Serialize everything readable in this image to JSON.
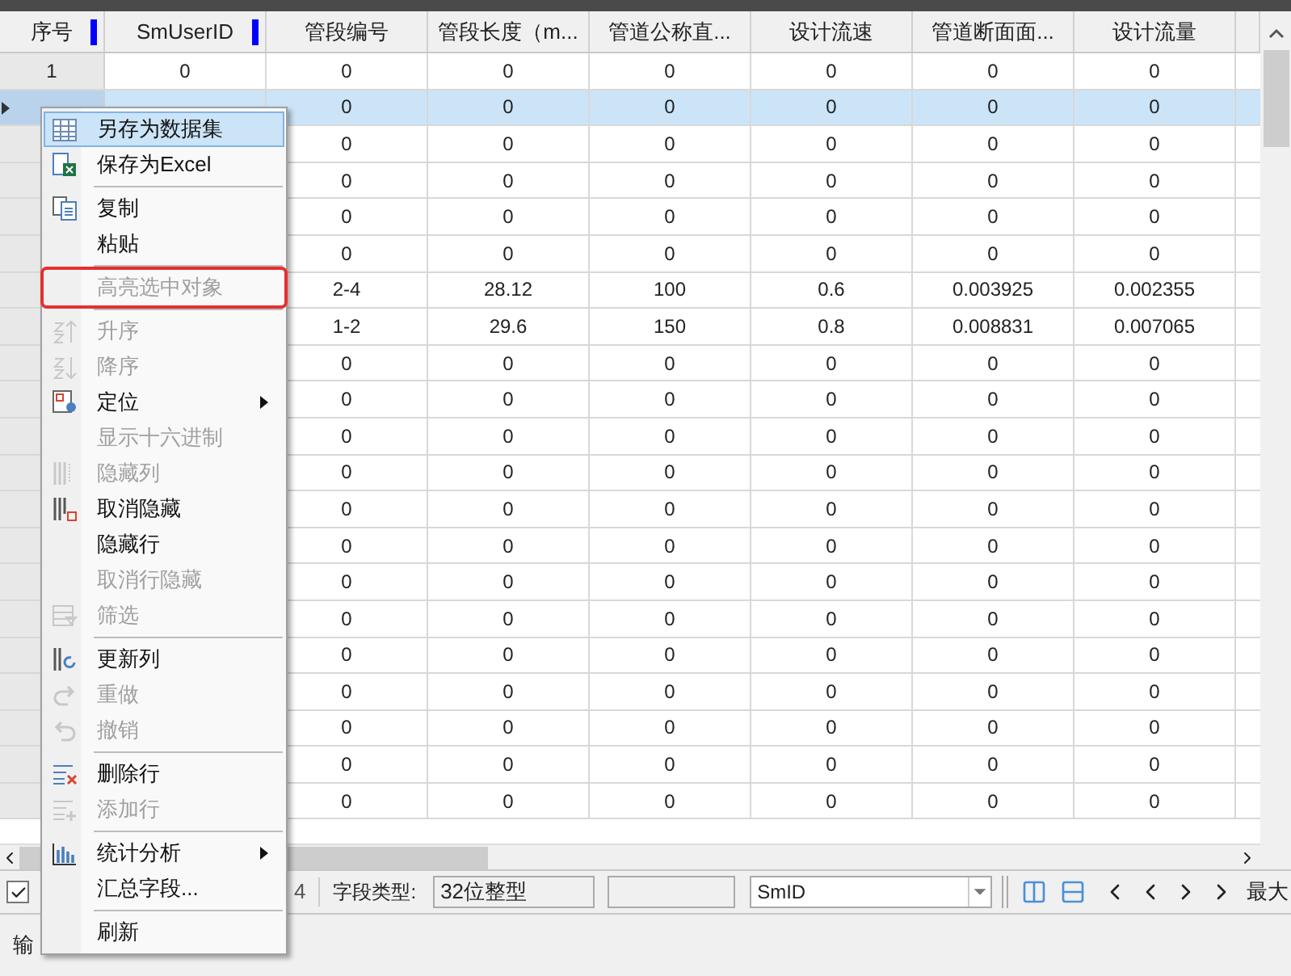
{
  "table": {
    "columns": [
      "序号",
      "SmUserID",
      "管段编号",
      "管段长度（m...",
      "管道公称直...",
      "设计流速",
      "管道断面面...",
      "设计流量"
    ],
    "rows": [
      {
        "selected": false,
        "cells": [
          "1",
          "0",
          "0",
          "0",
          "0",
          "0",
          "0",
          "0"
        ]
      },
      {
        "selected": true,
        "cells": [
          "",
          "",
          "0",
          "0",
          "0",
          "0",
          "0",
          "0"
        ]
      },
      {
        "selected": false,
        "cells": [
          "",
          "",
          "0",
          "0",
          "0",
          "0",
          "0",
          "0"
        ]
      },
      {
        "selected": false,
        "cells": [
          "",
          "",
          "0",
          "0",
          "0",
          "0",
          "0",
          "0"
        ]
      },
      {
        "selected": false,
        "cells": [
          "",
          "",
          "0",
          "0",
          "0",
          "0",
          "0",
          "0"
        ]
      },
      {
        "selected": false,
        "cells": [
          "",
          "",
          "0",
          "0",
          "0",
          "0",
          "0",
          "0"
        ]
      },
      {
        "selected": false,
        "cells": [
          "",
          "",
          "2-4",
          "28.12",
          "100",
          "0.6",
          "0.003925",
          "0.002355"
        ]
      },
      {
        "selected": false,
        "cells": [
          "",
          "",
          "1-2",
          "29.6",
          "150",
          "0.8",
          "0.008831",
          "0.007065"
        ]
      },
      {
        "selected": false,
        "cells": [
          "",
          "",
          "0",
          "0",
          "0",
          "0",
          "0",
          "0"
        ]
      },
      {
        "selected": false,
        "cells": [
          "",
          "",
          "0",
          "0",
          "0",
          "0",
          "0",
          "0"
        ]
      },
      {
        "selected": false,
        "cells": [
          "",
          "",
          "0",
          "0",
          "0",
          "0",
          "0",
          "0"
        ]
      },
      {
        "selected": false,
        "cells": [
          "",
          "",
          "0",
          "0",
          "0",
          "0",
          "0",
          "0"
        ]
      },
      {
        "selected": false,
        "cells": [
          "",
          "",
          "0",
          "0",
          "0",
          "0",
          "0",
          "0"
        ]
      },
      {
        "selected": false,
        "cells": [
          "",
          "",
          "0",
          "0",
          "0",
          "0",
          "0",
          "0"
        ]
      },
      {
        "selected": false,
        "cells": [
          "",
          "",
          "0",
          "0",
          "0",
          "0",
          "0",
          "0"
        ]
      },
      {
        "selected": false,
        "cells": [
          "",
          "",
          "0",
          "0",
          "0",
          "0",
          "0",
          "0"
        ]
      },
      {
        "selected": false,
        "cells": [
          "",
          "",
          "0",
          "0",
          "0",
          "0",
          "0",
          "0"
        ]
      },
      {
        "selected": false,
        "cells": [
          "",
          "",
          "0",
          "0",
          "0",
          "0",
          "0",
          "0"
        ]
      },
      {
        "selected": false,
        "cells": [
          "",
          "",
          "0",
          "0",
          "0",
          "0",
          "0",
          "0"
        ]
      },
      {
        "selected": false,
        "cells": [
          "",
          "",
          "0",
          "0",
          "0",
          "0",
          "0",
          "0"
        ]
      },
      {
        "selected": false,
        "cells": [
          "",
          "",
          "0",
          "0",
          "0",
          "0",
          "0",
          "0"
        ]
      }
    ]
  },
  "context_menu": [
    {
      "kind": "item",
      "label": "另存为数据集",
      "disabled": false,
      "selected": true,
      "submenu": false,
      "annotated": false
    },
    {
      "kind": "item",
      "label": "保存为Excel",
      "disabled": false,
      "selected": false,
      "submenu": false,
      "annotated": false
    },
    {
      "kind": "separator"
    },
    {
      "kind": "item",
      "label": "复制",
      "disabled": false,
      "selected": false,
      "submenu": false,
      "annotated": false
    },
    {
      "kind": "item",
      "label": "粘贴",
      "disabled": false,
      "selected": false,
      "submenu": false,
      "annotated": false
    },
    {
      "kind": "separator"
    },
    {
      "kind": "item",
      "label": "高亮选中对象",
      "disabled": true,
      "selected": false,
      "submenu": false,
      "annotated": true
    },
    {
      "kind": "separator"
    },
    {
      "kind": "item",
      "label": "升序",
      "disabled": true,
      "selected": false,
      "submenu": false,
      "annotated": false
    },
    {
      "kind": "item",
      "label": "降序",
      "disabled": true,
      "selected": false,
      "submenu": false,
      "annotated": false
    },
    {
      "kind": "item",
      "label": "定位",
      "disabled": false,
      "selected": false,
      "submenu": true,
      "annotated": false
    },
    {
      "kind": "item",
      "label": "显示十六进制",
      "disabled": true,
      "selected": false,
      "submenu": false,
      "annotated": false
    },
    {
      "kind": "item",
      "label": "隐藏列",
      "disabled": true,
      "selected": false,
      "submenu": false,
      "annotated": false
    },
    {
      "kind": "item",
      "label": "取消隐藏",
      "disabled": false,
      "selected": false,
      "submenu": false,
      "annotated": false
    },
    {
      "kind": "item",
      "label": "隐藏行",
      "disabled": false,
      "selected": false,
      "submenu": false,
      "annotated": false
    },
    {
      "kind": "item",
      "label": "取消行隐藏",
      "disabled": true,
      "selected": false,
      "submenu": false,
      "annotated": false
    },
    {
      "kind": "item",
      "label": "筛选",
      "disabled": true,
      "selected": false,
      "submenu": false,
      "annotated": false
    },
    {
      "kind": "separator"
    },
    {
      "kind": "item",
      "label": "更新列",
      "disabled": false,
      "selected": false,
      "submenu": false,
      "annotated": false
    },
    {
      "kind": "item",
      "label": "重做",
      "disabled": true,
      "selected": false,
      "submenu": false,
      "annotated": false
    },
    {
      "kind": "item",
      "label": "撤销",
      "disabled": true,
      "selected": false,
      "submenu": false,
      "annotated": false
    },
    {
      "kind": "separator"
    },
    {
      "kind": "item",
      "label": "删除行",
      "disabled": false,
      "selected": false,
      "submenu": false,
      "annotated": false
    },
    {
      "kind": "item",
      "label": "添加行",
      "disabled": true,
      "selected": false,
      "submenu": false,
      "annotated": false
    },
    {
      "kind": "separator"
    },
    {
      "kind": "item",
      "label": "统计分析",
      "disabled": false,
      "selected": false,
      "submenu": true,
      "annotated": false
    },
    {
      "kind": "item",
      "label": "汇总字段...",
      "disabled": false,
      "selected": false,
      "submenu": false,
      "annotated": false
    },
    {
      "kind": "separator"
    },
    {
      "kind": "item",
      "label": "刷新",
      "disabled": false,
      "selected": false,
      "submenu": false,
      "annotated": false
    }
  ],
  "status_bar": {
    "checkbox": {
      "checked": true
    },
    "record_count": "4",
    "field_type_label": "字段类型:",
    "field_type_value": "32位整型",
    "field_select": "SmID",
    "max_label": "最大"
  },
  "output_panel": {
    "title": "输"
  }
}
